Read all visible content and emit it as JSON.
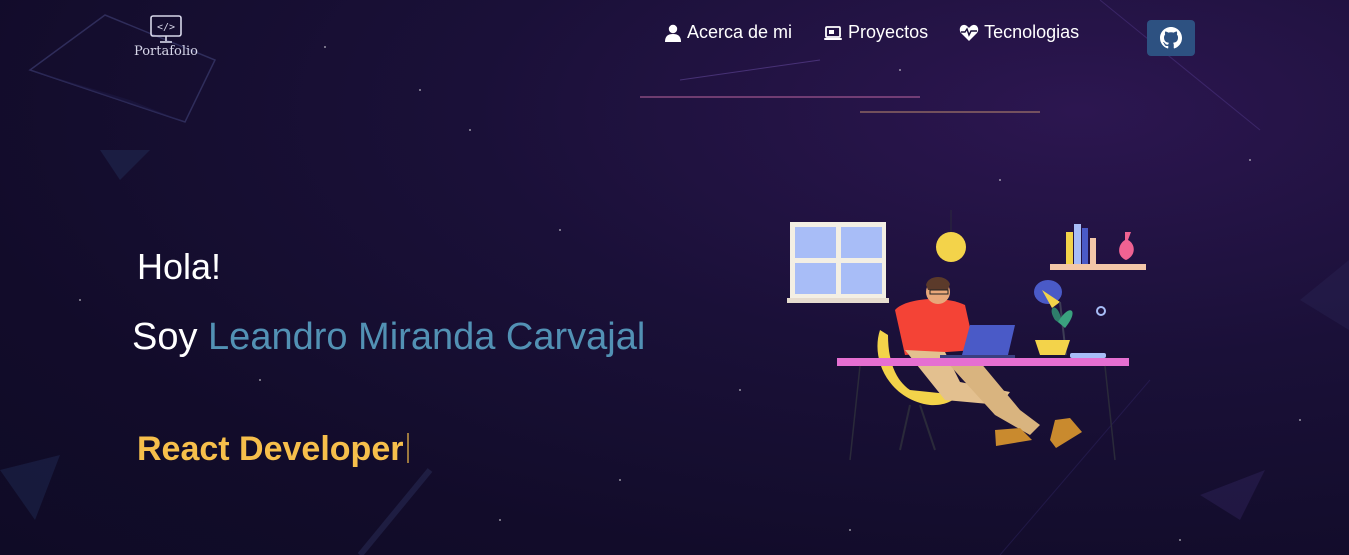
{
  "brand": {
    "logo_text": "Portafolio",
    "icon": "code-monitor-icon"
  },
  "nav": {
    "items": [
      {
        "label": "Acerca de mi",
        "icon": "user-icon"
      },
      {
        "label": "Proyectos",
        "icon": "laptop-icon"
      },
      {
        "label": "Tecnologias",
        "icon": "heart-pulse-icon"
      }
    ],
    "github_icon": "github-icon"
  },
  "hero": {
    "greeting": "Hola!",
    "intro_prefix": "Soy",
    "name": "Leandro Miranda Carvajal",
    "role": "React Developer"
  },
  "illustration": "developer-at-desk-illustration",
  "colors": {
    "background": "#140d2e",
    "name_accent": "#5291b4",
    "role_accent": "#f6bf4b",
    "github_button": "#2d5181"
  }
}
